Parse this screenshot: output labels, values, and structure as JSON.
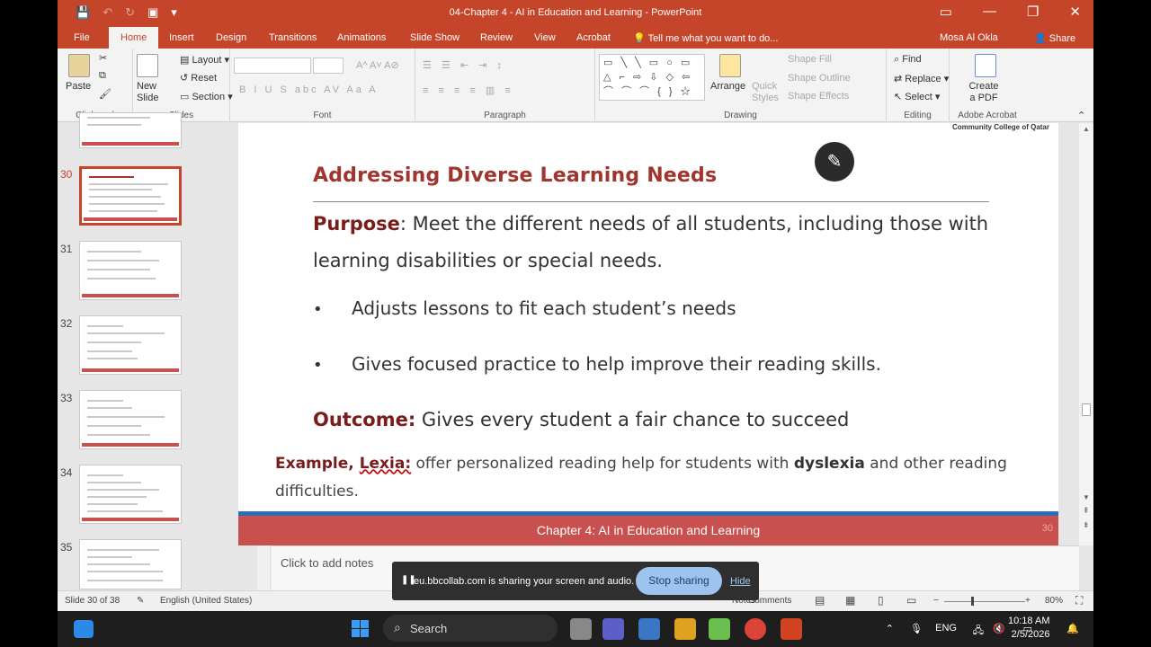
{
  "window": {
    "title": "04-Chapter 4 - AI in Education and Learning - PowerPoint",
    "controls": [
      "▭",
      "—",
      "❐",
      "✕"
    ]
  },
  "tabs": [
    "File",
    "Home",
    "Insert",
    "Design",
    "Transitions",
    "Animations",
    "Slide Show",
    "Review",
    "View",
    "Acrobat"
  ],
  "active_tab": "Home",
  "tell_me": "Tell me what you want to do...",
  "user": "Mosa Al Okla",
  "share_label": "Share",
  "ribbon": {
    "clipboard": {
      "paste": "Paste",
      "label": "Clipboard"
    },
    "slides": {
      "new_slide": "New Slide",
      "layout": "Layout",
      "reset": "Reset",
      "section": "Section",
      "label": "Slides"
    },
    "font": {
      "label": "Font",
      "buttons": "B  I  U  S  abc  AV  Aa  A"
    },
    "paragraph": {
      "label": "Paragraph"
    },
    "drawing": {
      "label": "Drawing",
      "arrange": "Arrange",
      "quick_styles": "Quick Styles",
      "shape_fill": "Shape Fill",
      "shape_outline": "Shape Outline",
      "shape_effects": "Shape Effects",
      "shapes_row1": "▭ ╲ ╲ ▭ ○ ▭",
      "shapes_row2": "△ ⌐ ⇨ ⇩ ◇ ⇦",
      "shapes_row3": "⌒ ⌒ ⌒ { } ☆"
    },
    "editing": {
      "label": "Editing",
      "find": "Find",
      "replace": "Replace",
      "select": "Select"
    },
    "acrobat": {
      "label": "Adobe Acrobat",
      "create_pdf": "Create a PDF"
    }
  },
  "thumbnails": [
    {
      "num": "30",
      "active": true
    },
    {
      "num": "31",
      "active": false
    },
    {
      "num": "32",
      "active": false
    },
    {
      "num": "33",
      "active": false
    },
    {
      "num": "34",
      "active": false
    },
    {
      "num": "35",
      "active": false
    }
  ],
  "slide": {
    "college": "Community College of Qatar",
    "title": "Addressing Diverse Learning Needs",
    "purpose_kw": "Purpose",
    "purpose_text": ": Meet the different needs of all students, including those with learning disabilities or special needs.",
    "bullets": [
      "Adjusts lessons to fit each student’s needs",
      "Gives focused practice to help improve their reading skills."
    ],
    "outcome_kw": "Outcome:",
    "outcome_text": " Gives every student a fair chance to succeed",
    "example_kw1": "Example",
    "example_comma": ", ",
    "example_kw2": "Lexia:",
    "example_text1": " offer personalized reading help for students with ",
    "example_bold": "dyslexia",
    "example_text2": " and other reading difficulties.",
    "footer": "Chapter 4: AI in Education and Learning",
    "page": "30"
  },
  "notes_placeholder": "Click to add notes",
  "status": {
    "slide_of": "Slide 30 of 38",
    "language": "English (United States)",
    "notes": "Notes",
    "comments": "Comments",
    "zoom": "80%"
  },
  "share_banner": {
    "message": "eu.bbcollab.com is sharing your screen and audio.",
    "stop": "Stop sharing",
    "hide": "Hide"
  },
  "taskbar": {
    "search": "Search",
    "lang": "ENG",
    "time": "10:18 AM",
    "date": "2/5/2026"
  }
}
